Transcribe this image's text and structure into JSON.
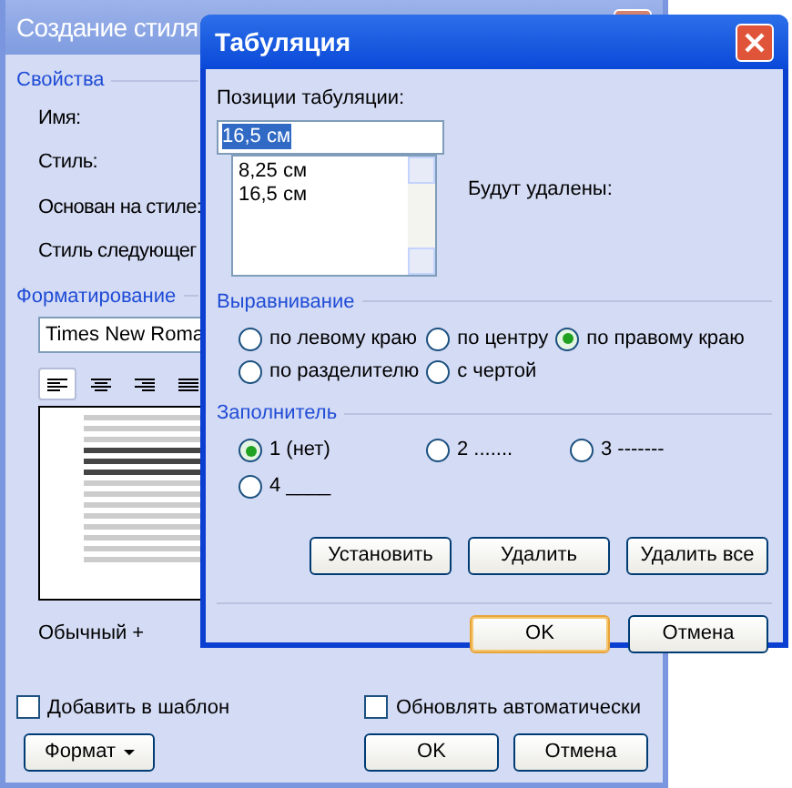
{
  "back_window": {
    "title": "Создание стиля",
    "properties_group": {
      "title": "Свойства",
      "labels": [
        "Имя:",
        "Стиль:",
        "Основан на стиле:",
        "Стиль следующег"
      ]
    },
    "formatting_group": {
      "title": "Форматирование",
      "font": "Times New Roma",
      "alignment_buttons": [
        {
          "kind": "left",
          "selected": true
        },
        {
          "kind": "center",
          "selected": false
        },
        {
          "kind": "right",
          "selected": false
        },
        {
          "kind": "justify",
          "selected": false
        }
      ],
      "style_description": "Обычный +"
    },
    "checkboxes": [
      {
        "label": "Добавить в шаблон",
        "checked": false
      },
      {
        "label": "Обновлять автоматически",
        "checked": false
      }
    ],
    "format_button": "Формат",
    "buttons": [
      {
        "label": "OK",
        "default": false
      },
      {
        "label": "Отмена",
        "default": false
      }
    ]
  },
  "front_window": {
    "title": "Табуляция",
    "tab_positions_label": "Позиции табуляции:",
    "tab_position_value": "16,5 см",
    "tab_positions": [
      "8,25 см",
      "16,5 см"
    ],
    "to_be_cleared_label": "Будут удалены:",
    "alignment": {
      "title": "Выравнивание",
      "options": [
        {
          "label": "по левому краю",
          "selected": false
        },
        {
          "label": "по центру",
          "selected": false
        },
        {
          "label": "по правому краю",
          "selected": true
        },
        {
          "label": "по разделителю",
          "selected": false
        },
        {
          "label": "с чертой",
          "selected": false
        }
      ]
    },
    "leader": {
      "title": "Заполнитель",
      "options": [
        {
          "label": "1 (нет)",
          "selected": true
        },
        {
          "label": "2 .......",
          "selected": false
        },
        {
          "label": "3 -------",
          "selected": false
        },
        {
          "label": "4 ____",
          "selected": false
        }
      ]
    },
    "action_buttons": [
      "Установить",
      "Удалить",
      "Удалить все"
    ],
    "buttons": [
      {
        "label": "OK",
        "default": true
      },
      {
        "label": "Отмена",
        "default": false
      }
    ]
  }
}
